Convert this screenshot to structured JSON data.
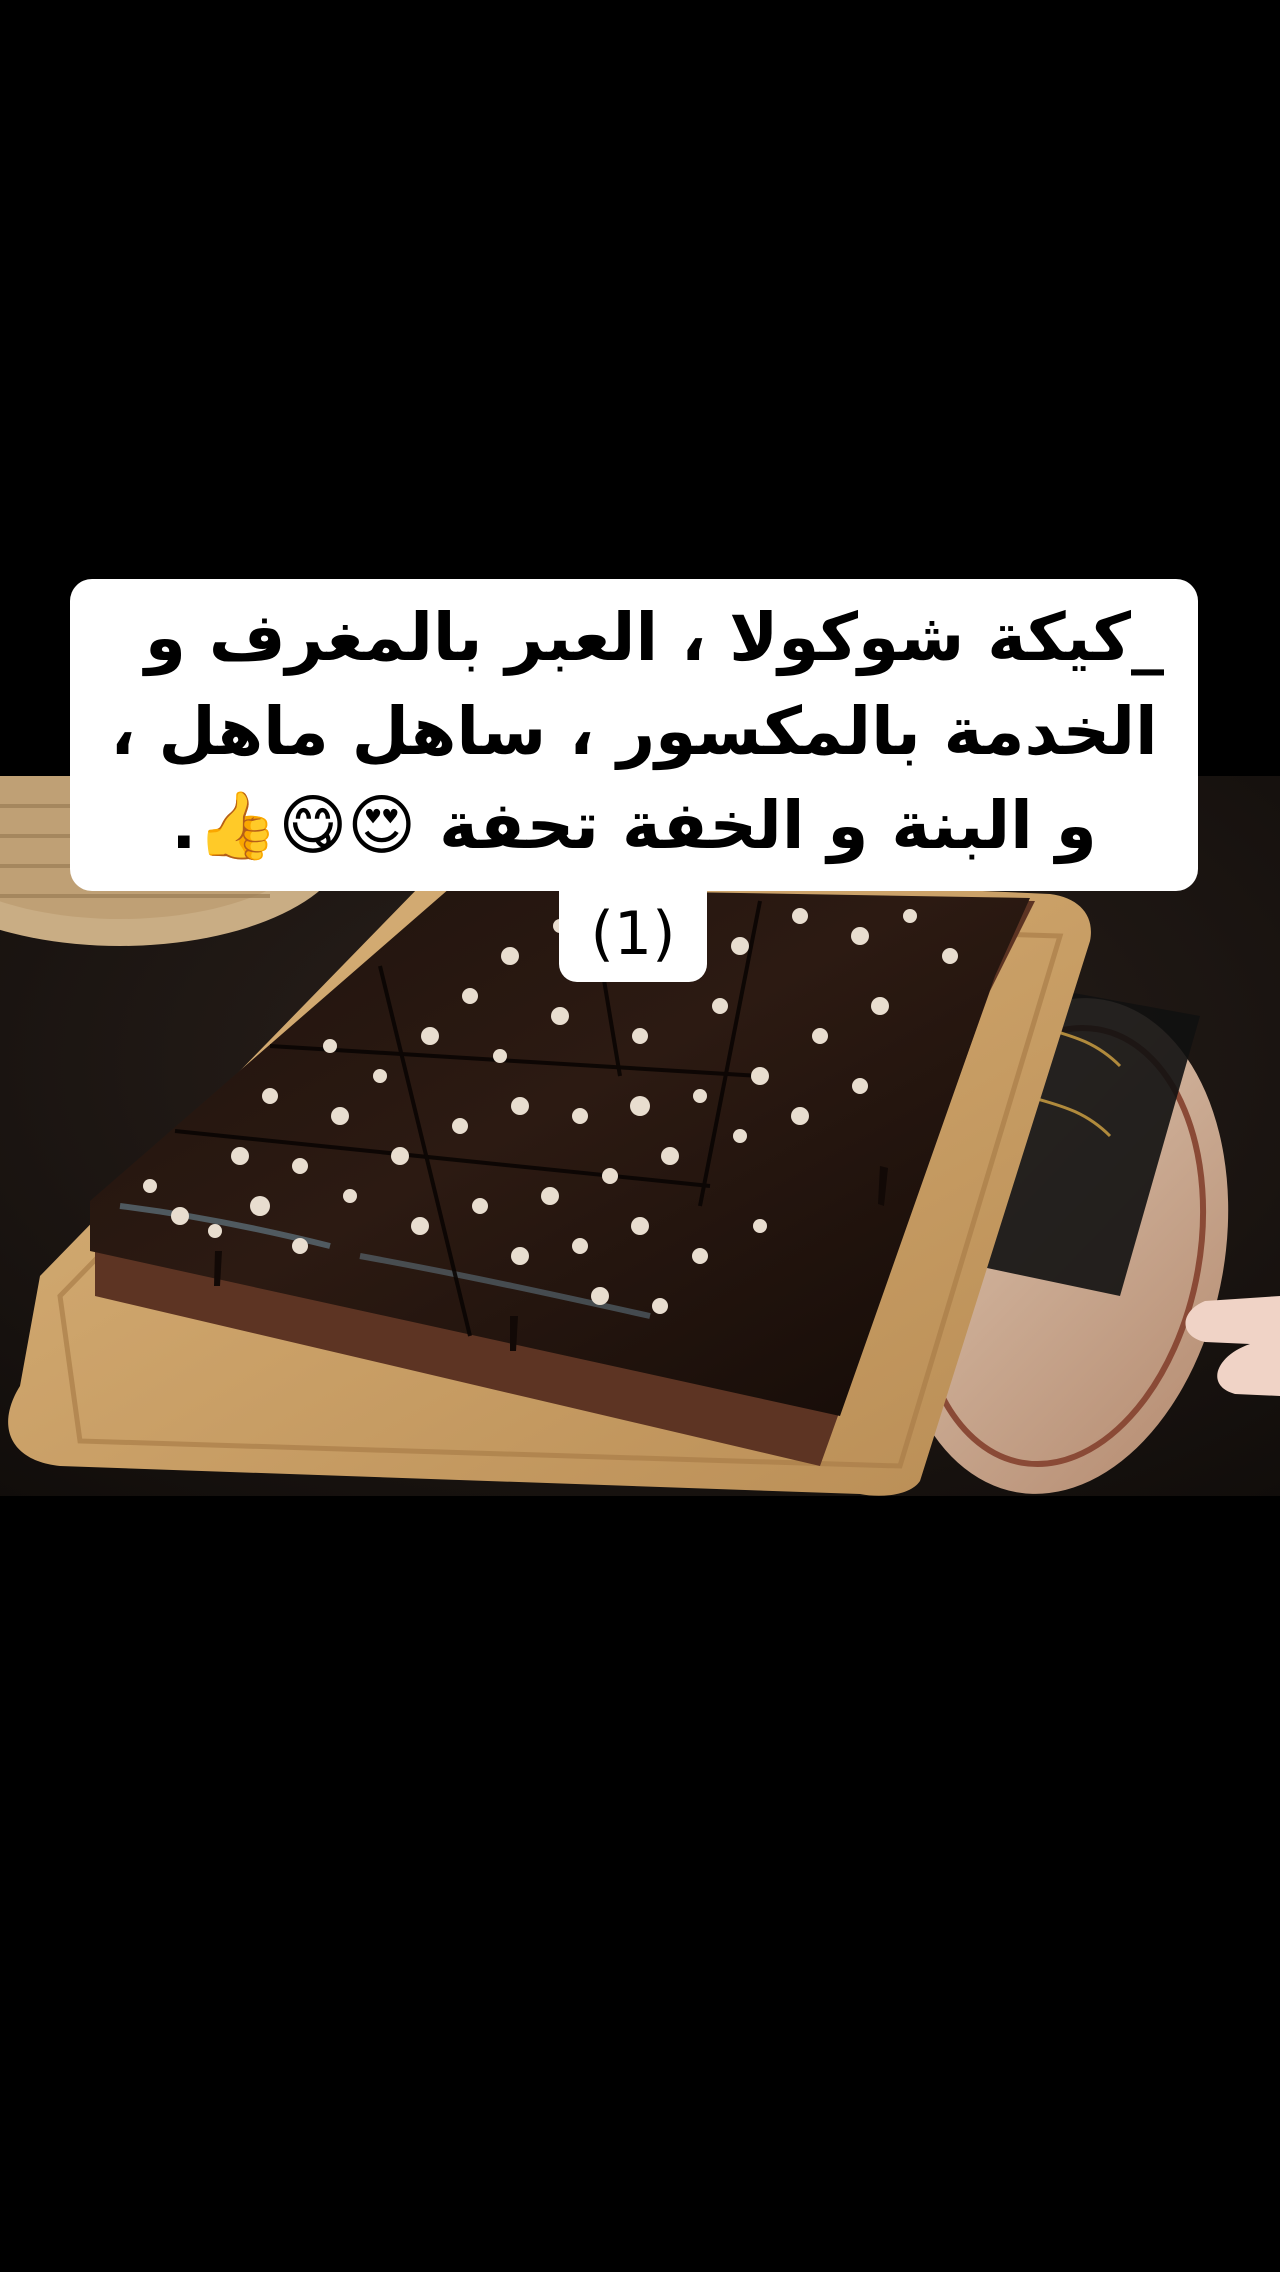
{
  "caption": {
    "lines": [
      "_كيكة شوكولا ، العبر بالمغرف و",
      "الخدمة بالمكسور ، ساهل ماهل ،",
      "و البنة و الخفة تحفة 😍😋👍."
    ],
    "part_label": "(1)"
  },
  "video": {
    "subject": "chocolate-cake-on-wooden-board"
  },
  "colors": {
    "background": "#000000",
    "caption_bg": "#ffffff",
    "caption_text": "#000000"
  }
}
